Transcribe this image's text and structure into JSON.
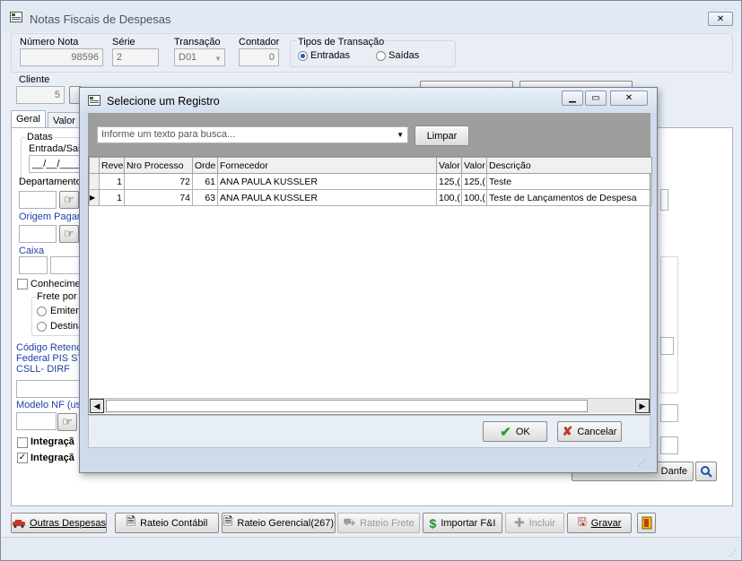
{
  "main": {
    "title": "Notas Fiscais de Despesas",
    "numero_nota": {
      "label": "Número Nota",
      "value": "98596"
    },
    "serie": {
      "label": "Série",
      "value": "2"
    },
    "transacao": {
      "label": "Transação",
      "value": "D01"
    },
    "contador": {
      "label": "Contador",
      "value": "0"
    },
    "tipos_transacao": {
      "label": "Tipos de Transação",
      "entradas": "Entradas",
      "saidas": "Saídas",
      "selected": "Entradas"
    },
    "cliente": {
      "label": "Cliente",
      "value": "5"
    },
    "tabs": [
      "Geral",
      "Valor"
    ],
    "datas": "Datas",
    "entrada_saida": "Entrada/Sai",
    "date_value": "__/__/____",
    "departamento": "Departamento",
    "origem_pagamento": "Origem Pagam",
    "caixa": "Caixa",
    "conhecimento": "Conhecimen",
    "frete_por": "Frete por",
    "emitente": "Emiten",
    "destinatario": "Destina",
    "codigo_retencao": "Código Retenç",
    "federal_pis": "Federal PIS ST",
    "csll_dirf": "CSLL- DIRF",
    "modelo_nf": "Modelo NF (usa",
    "integracao1": "Integraçã",
    "integracao2": "Integraçã",
    "danfe_button": "Danfe"
  },
  "toolbar": {
    "outras_despesas": "Outras Despesas",
    "rateio_contabil": "Rateio Contábil",
    "rateio_gerencial": "Rateio Gerencial(267)",
    "rateio_frete": "Rateio Frete",
    "importar": "Importar F&I",
    "incluir": "Incluir",
    "gravar": "Gravar"
  },
  "dialog": {
    "title": "Selecione um Registro",
    "search_placeholder": "Informe um texto para busca...",
    "clear_button": "Limpar",
    "columns": [
      "Reve",
      "Nro Processo",
      "Orde",
      "Fornecedor",
      "Valor",
      "Valor",
      "Descrição"
    ],
    "rows": [
      [
        "1",
        "72",
        "61",
        "ANA PAULA KUSSLER",
        "125,(",
        "125,(",
        "Teste"
      ],
      [
        "1",
        "74",
        "63",
        "ANA PAULA KUSSLER",
        "100,(",
        "100,(",
        "Teste de Lançamentos de Despesa"
      ]
    ],
    "ok_button": "OK",
    "cancel_button": "Cancelar"
  }
}
